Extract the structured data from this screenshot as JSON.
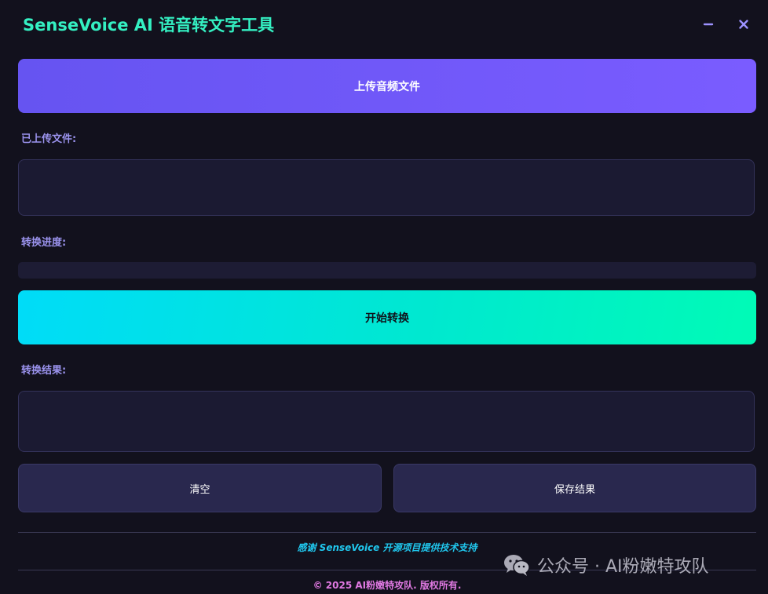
{
  "window": {
    "title": "SenseVoice AI 语音转文字工具",
    "minimize_icon": "minimize-icon",
    "close_icon": "close-icon"
  },
  "upload": {
    "button_label": "上传音频文件"
  },
  "uploaded_files": {
    "label": "已上传文件:",
    "value": ""
  },
  "progress": {
    "label": "转换进度:",
    "value_percent": 0
  },
  "convert": {
    "button_label": "开始转换"
  },
  "result": {
    "label": "转换结果:",
    "value": ""
  },
  "actions": {
    "clear_label": "清空",
    "save_label": "保存结果"
  },
  "footer": {
    "thanks": "感谢 SenseVoice 开源项目提供技术支持",
    "copyright": "© 2025 AI粉嫩特攻队. 版权所有."
  },
  "watermark": {
    "text": "公众号 · AI粉嫩特攻队",
    "icon": "wechat-icon"
  },
  "colors": {
    "background": "#12111d",
    "title": "#34f0c2",
    "upload_gradient_start": "#6654f1",
    "upload_gradient_end": "#7a5cff",
    "convert_gradient_start": "#00dcf8",
    "convert_gradient_end": "#00fbb6",
    "label": "#9b93ee",
    "thanks": "#20c8ef",
    "copyright": "#e079e2"
  }
}
